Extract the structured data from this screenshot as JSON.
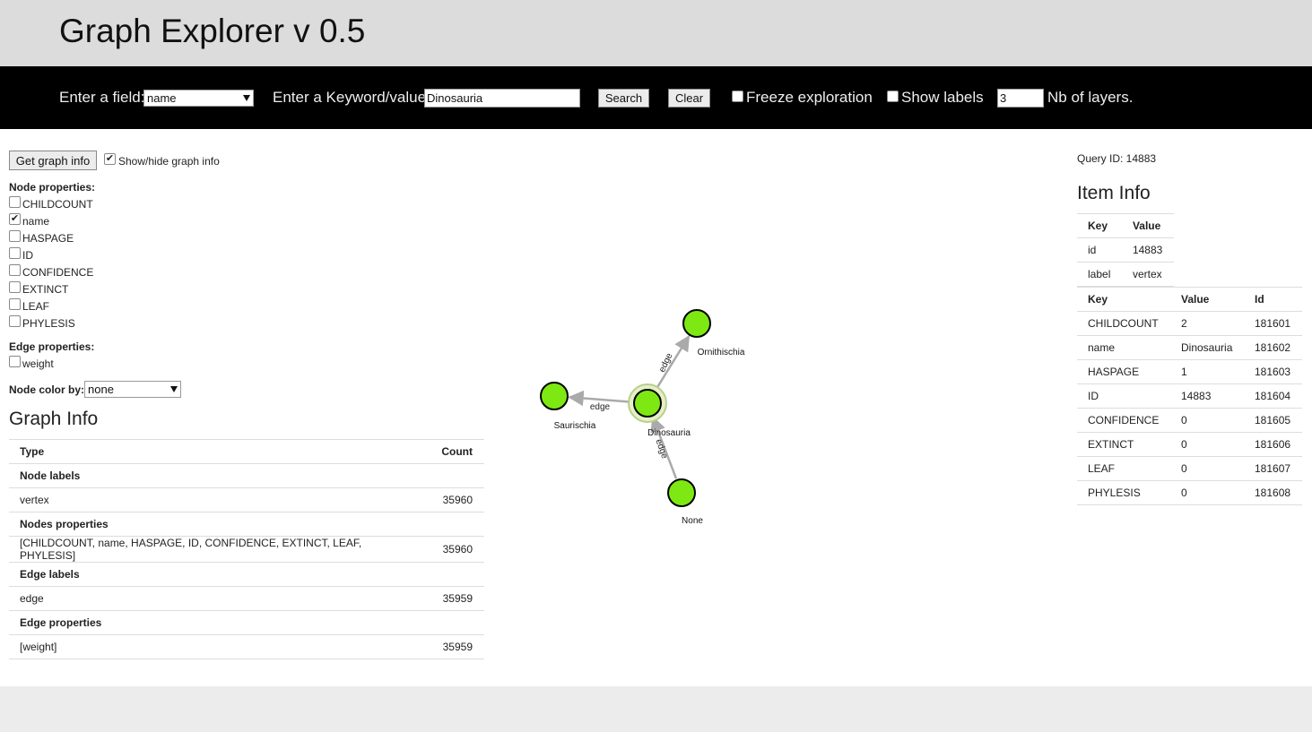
{
  "app": {
    "title": "Graph Explorer v 0.5"
  },
  "toolbar": {
    "field_label": "Enter a field:",
    "field_value": "name",
    "keyword_label": "Enter a Keyword/value:",
    "keyword_value": "Dinosauria",
    "search_label": "Search",
    "clear_label": "Clear",
    "freeze_label": "Freeze exploration",
    "freeze_checked": false,
    "show_labels_label": "Show labels",
    "show_labels_checked": false,
    "layers_value": "3",
    "layers_label": "Nb of layers."
  },
  "left": {
    "get_info_label": "Get graph info",
    "show_hide_label": "Show/hide graph info",
    "show_hide_checked": true,
    "node_props_title": "Node properties:",
    "node_props": [
      {
        "label": "CHILDCOUNT",
        "checked": false
      },
      {
        "label": "name",
        "checked": true
      },
      {
        "label": "HASPAGE",
        "checked": false
      },
      {
        "label": "ID",
        "checked": false
      },
      {
        "label": "CONFIDENCE",
        "checked": false
      },
      {
        "label": "EXTINCT",
        "checked": false
      },
      {
        "label": "LEAF",
        "checked": false
      },
      {
        "label": "PHYLESIS",
        "checked": false
      }
    ],
    "edge_props_title": "Edge properties:",
    "edge_props": [
      {
        "label": "weight",
        "checked": false
      }
    ],
    "node_color_label": "Node color by:",
    "node_color_value": "none"
  },
  "graph_info": {
    "title": "Graph Info",
    "headers": {
      "type": "Type",
      "count": "Count"
    },
    "rows": [
      {
        "type": "Node labels",
        "count": "",
        "group": true
      },
      {
        "type": "vertex",
        "count": "35960",
        "group": false
      },
      {
        "type": "Nodes properties",
        "count": "",
        "group": true
      },
      {
        "type": "[CHILDCOUNT, name, HASPAGE, ID, CONFIDENCE, EXTINCT, LEAF, PHYLESIS]",
        "count": "35960",
        "group": false
      },
      {
        "type": "Edge labels",
        "count": "",
        "group": true
      },
      {
        "type": "edge",
        "count": "35959",
        "group": false
      },
      {
        "type": "Edge properties",
        "count": "",
        "group": true
      },
      {
        "type": "[weight]",
        "count": "35959",
        "group": false
      }
    ]
  },
  "graph": {
    "node_color": "#7ee812",
    "edge_color": "#aaaaaa",
    "nodes": [
      {
        "name": "Dinosauria",
        "selected": true
      },
      {
        "name": "Ornithischia",
        "selected": false
      },
      {
        "name": "Saurischia",
        "selected": false
      },
      {
        "name": "None",
        "selected": false
      }
    ],
    "edge_label": "edge"
  },
  "right": {
    "query_label": "Query ID: 14883",
    "item_info_title": "Item Info",
    "basic": {
      "headers": {
        "key": "Key",
        "value": "Value"
      },
      "rows": [
        {
          "key": "id",
          "value": "14883"
        },
        {
          "key": "label",
          "value": "vertex"
        }
      ]
    },
    "props": {
      "headers": {
        "key": "Key",
        "value": "Value",
        "id": "Id"
      },
      "rows": [
        {
          "key": "CHILDCOUNT",
          "value": "2",
          "id": "181601"
        },
        {
          "key": "name",
          "value": "Dinosauria",
          "id": "181602"
        },
        {
          "key": "HASPAGE",
          "value": "1",
          "id": "181603"
        },
        {
          "key": "ID",
          "value": "14883",
          "id": "181604"
        },
        {
          "key": "CONFIDENCE",
          "value": "0",
          "id": "181605"
        },
        {
          "key": "EXTINCT",
          "value": "0",
          "id": "181606"
        },
        {
          "key": "LEAF",
          "value": "0",
          "id": "181607"
        },
        {
          "key": "PHYLESIS",
          "value": "0",
          "id": "181608"
        }
      ]
    }
  }
}
